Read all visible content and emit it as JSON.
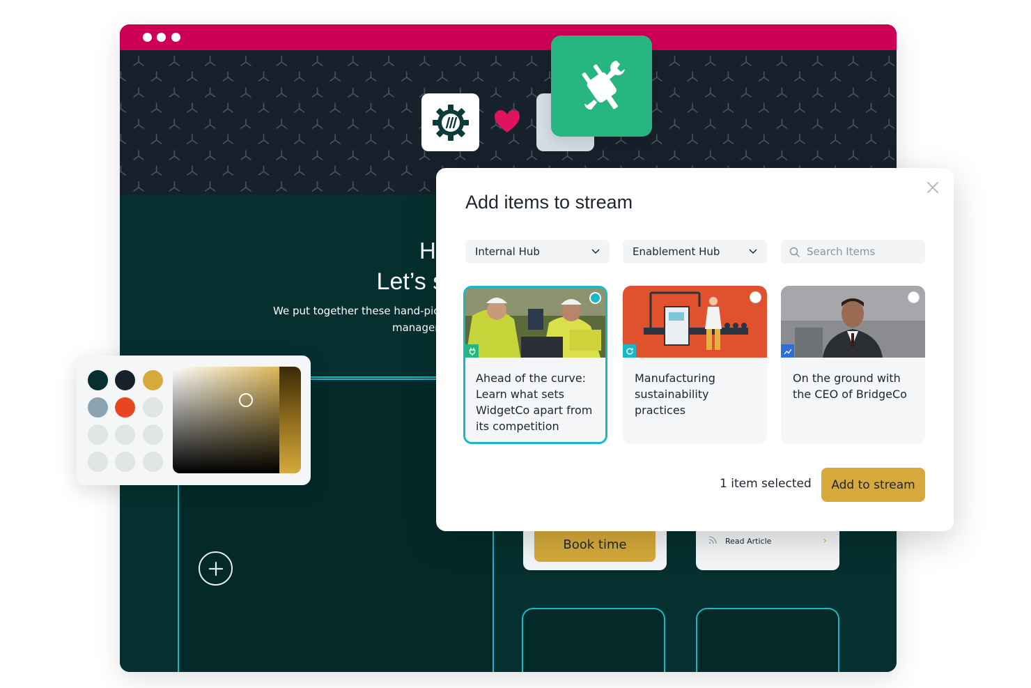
{
  "hero": {
    "greeting": "H",
    "headline": "Let’s start stre",
    "subtext_line1": "We put together these hand-picke",
    "subtext_line2": "managen"
  },
  "background_cards": {
    "book_label": "Book time",
    "read_label": "Read Article"
  },
  "color_picker": {
    "swatches": [
      "#05302f",
      "#17212b",
      "#d5aa3a",
      "#8ba3b0",
      "#e84522",
      "#e0e4e2",
      "#e0e4e2",
      "#e0e4e2",
      "#e0e4e2",
      "#e0e4e2",
      "#e0e4e2",
      "#e0e4e2"
    ],
    "selected_color": "#d5aa3a"
  },
  "modal": {
    "title": "Add items to stream",
    "hub_select": "Internal Hub",
    "subhub_select": "Enablement Hub",
    "search_placeholder": "Search Items",
    "items": [
      {
        "title": "Ahead of the curve: Learn what sets WidgetCo apart from its competition",
        "selected": true,
        "badge_color": "#27b682"
      },
      {
        "title": "Manufacturing sustainability practices",
        "selected": false,
        "badge_color": "#1ab8c5"
      },
      {
        "title": "On the ground with the CEO of BridgeCo",
        "selected": false,
        "badge_color": "#2d6fd6"
      }
    ],
    "selection_count": "1 item selected",
    "add_button": "Add to stream"
  },
  "colors": {
    "brand_pink": "#cc0055",
    "dark_navy": "#17212b",
    "dark_teal": "#05302f",
    "accent_teal": "#1ab8c5",
    "gold": "#d5aa3a",
    "green": "#27b682"
  }
}
